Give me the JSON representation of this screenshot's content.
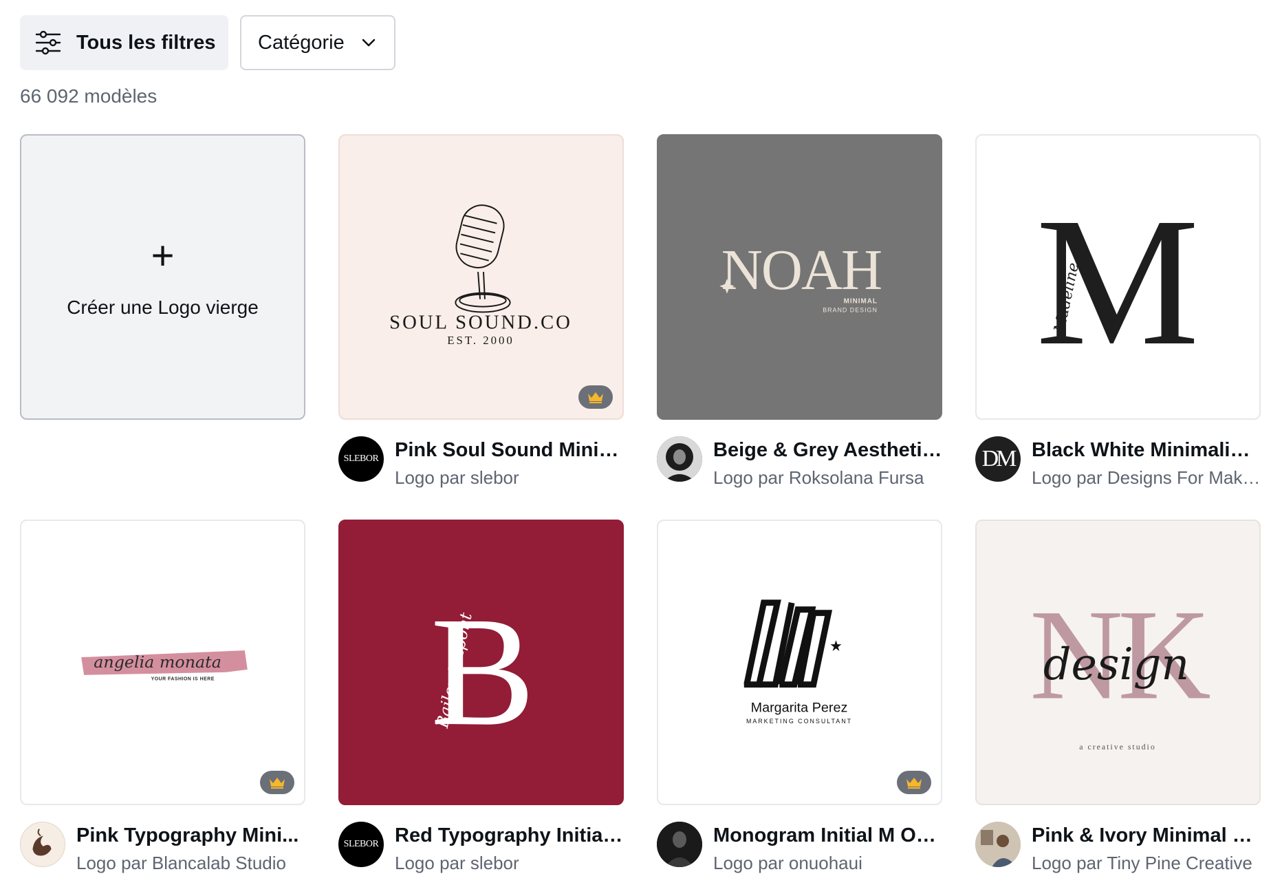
{
  "filters": {
    "all_filters_label": "Tous les filtres",
    "category_label": "Catégorie"
  },
  "results_count": "66 092 modèles",
  "blank_card": {
    "label": "Créer une Logo vierge"
  },
  "colors": {
    "accent_crown": "#f5b72b",
    "crown_bg": "#6b6f77",
    "muted_text": "#5e6570"
  },
  "templates": [
    {
      "title": "Pink Soul Sound Minim...",
      "author": "Logo par slebor",
      "premium": true,
      "avatar_text": "SLEBOR",
      "logo_text": "SOUL SOUND.CO",
      "logo_subtext": "EST. 2000"
    },
    {
      "title": "Beige & Grey Aesthetic...",
      "author": "Logo par Roksolana Fursa",
      "premium": false,
      "logo_text": "NOAH",
      "logo_subtext": "MINIMAL",
      "logo_subtext2": "BRAND DESIGN"
    },
    {
      "title": "Black White Minimalist...",
      "author": "Logo par Designs For Makers",
      "premium": false,
      "avatar_text": "DM",
      "logo_text": "M",
      "logo_script": "Madeline"
    },
    {
      "title": "Pink Typography Mini...",
      "author": "Logo par Blancalab Studio",
      "premium": true,
      "logo_text": "angelia monata",
      "logo_subtext": "YOUR FASHION IS HERE"
    },
    {
      "title": "Red Typography Initial ...",
      "author": "Logo par slebor",
      "premium": false,
      "avatar_text": "SLEBOR",
      "logo_text": "B",
      "logo_script": "Bailey Dupont"
    },
    {
      "title": "Monogram Initial M On...",
      "author": "Logo par onuohaui",
      "premium": true,
      "logo_text": "Margarita Perez",
      "logo_subtext": "MARKETING CONSULTANT"
    },
    {
      "title": "Pink & Ivory Minimal S...",
      "author": "Logo par Tiny Pine Creative",
      "premium": false,
      "logo_text": "NK",
      "logo_script": "design",
      "logo_subtext": "a creative studio"
    }
  ]
}
